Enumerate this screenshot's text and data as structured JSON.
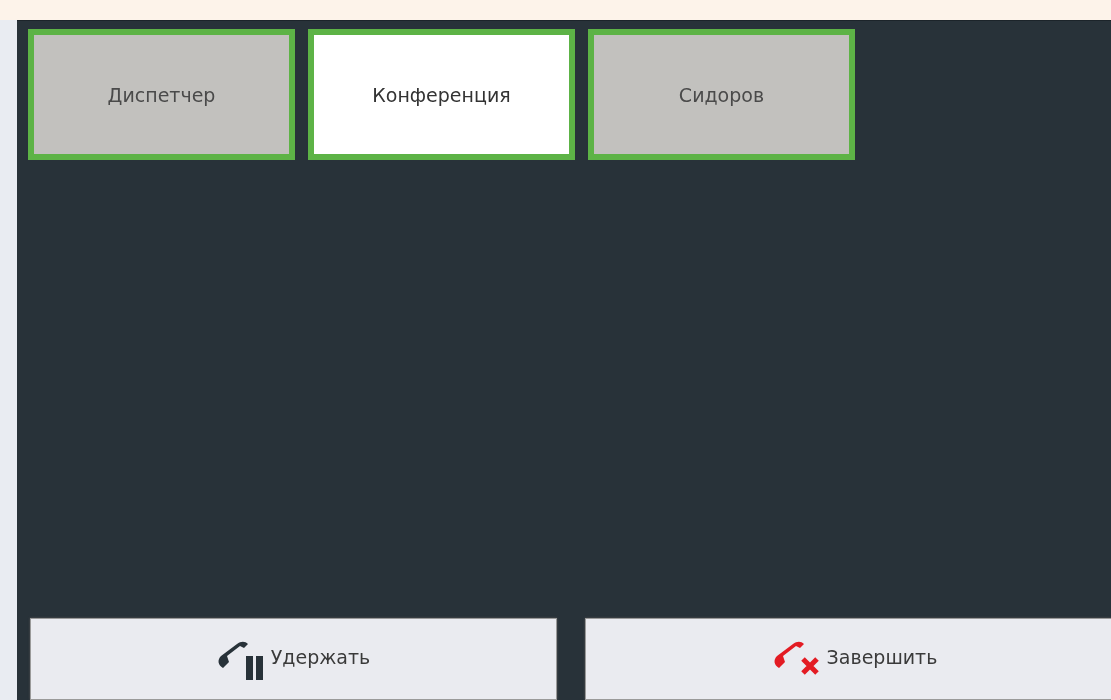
{
  "calls": [
    {
      "label": "Диспетчер",
      "selected": false
    },
    {
      "label": "Конференция",
      "selected": true
    },
    {
      "label": "Сидоров",
      "selected": false
    }
  ],
  "actions": [
    {
      "label": "Удержать",
      "kind": "hold"
    },
    {
      "label": "Завершить",
      "kind": "end"
    }
  ]
}
